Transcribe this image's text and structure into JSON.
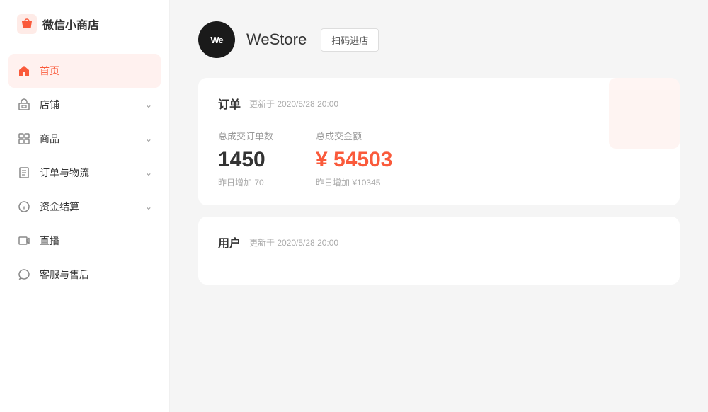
{
  "app": {
    "title": "微信小商店"
  },
  "store": {
    "avatar_text": "We",
    "name": "WeStore",
    "scan_btn_label": "扫码进店"
  },
  "sidebar": {
    "items": [
      {
        "id": "home",
        "label": "首页",
        "icon": "home-icon",
        "active": true,
        "arrow": false
      },
      {
        "id": "shop",
        "label": "店铺",
        "icon": "shop-icon",
        "active": false,
        "arrow": true
      },
      {
        "id": "goods",
        "label": "商品",
        "icon": "goods-icon",
        "active": false,
        "arrow": true
      },
      {
        "id": "orders",
        "label": "订单与物流",
        "icon": "orders-icon",
        "active": false,
        "arrow": true
      },
      {
        "id": "finance",
        "label": "资金结算",
        "icon": "finance-icon",
        "active": false,
        "arrow": true
      },
      {
        "id": "live",
        "label": "直播",
        "icon": "live-icon",
        "active": false,
        "arrow": false
      },
      {
        "id": "service",
        "label": "客服与售后",
        "icon": "service-icon",
        "active": false,
        "arrow": false
      }
    ]
  },
  "orders_card": {
    "title": "订单",
    "update_text": "更新于 2020/5/28 20:00",
    "stats": [
      {
        "label": "总成交订单数",
        "value": "1450",
        "highlight": false,
        "sub": "昨日增加  70"
      },
      {
        "label": "总成交金额",
        "value": "¥ 54503",
        "highlight": true,
        "sub": "昨日增加 ¥10345"
      }
    ]
  },
  "users_card": {
    "title": "用户",
    "update_text": "更新于 2020/5/28 20:00"
  }
}
